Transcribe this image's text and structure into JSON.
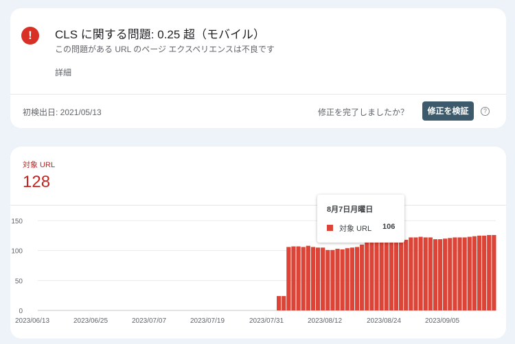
{
  "issue": {
    "title": "CLS に関する問題: 0.25 超（モバイル）",
    "subtitle": "この問題がある URL のページ エクスペリエンスは不良です",
    "details_link": "詳細",
    "first_detected": "初検出日: 2021/05/13",
    "fix_question": "修正を完了しましたか？",
    "validate_label": "修正を検証",
    "error_icon": "!",
    "help_icon": "?"
  },
  "summary": {
    "label": "対象 URL",
    "value": "128"
  },
  "tooltip": {
    "date": "8月7日月曜日",
    "series": "対象 URL",
    "value": "106"
  },
  "colors": {
    "bar": "#db4437",
    "bar_faded": "#f4c7c3",
    "error": "#d93025",
    "accent_text": "#c5221f",
    "button": "#3d5a6c"
  },
  "chart_data": {
    "type": "bar",
    "series": [
      {
        "name": "対象 URL"
      }
    ],
    "ylim": [
      0,
      150
    ],
    "yticks": [
      0,
      50,
      100,
      150
    ],
    "xtick_labels": [
      "2023/06/13",
      "2023/06/25",
      "2023/07/07",
      "2023/07/19",
      "2023/07/31",
      "2023/08/12",
      "2023/08/24",
      "2023/09/05"
    ],
    "start_date": "2023/06/13",
    "grid": true,
    "legend": "none",
    "highlight_index": 55,
    "values": [
      0,
      0,
      0,
      0,
      0,
      0,
      0,
      0,
      0,
      0,
      0,
      0,
      0,
      0,
      0,
      0,
      0,
      0,
      0,
      0,
      0,
      0,
      0,
      0,
      0,
      0,
      0,
      0,
      0,
      0,
      0,
      0,
      0,
      0,
      0,
      0,
      0,
      0,
      0,
      0,
      0,
      0,
      0,
      0,
      0,
      0,
      0,
      0,
      0,
      0,
      24,
      24,
      106,
      107,
      107,
      106,
      108,
      106,
      105,
      105,
      101,
      101,
      103,
      102,
      104,
      105,
      106,
      110,
      114,
      114,
      115,
      115,
      116,
      116,
      117,
      117,
      118,
      122,
      122,
      123,
      122,
      122,
      119,
      119,
      120,
      121,
      122,
      122,
      122,
      123,
      124,
      125,
      125,
      126,
      126
    ]
  }
}
